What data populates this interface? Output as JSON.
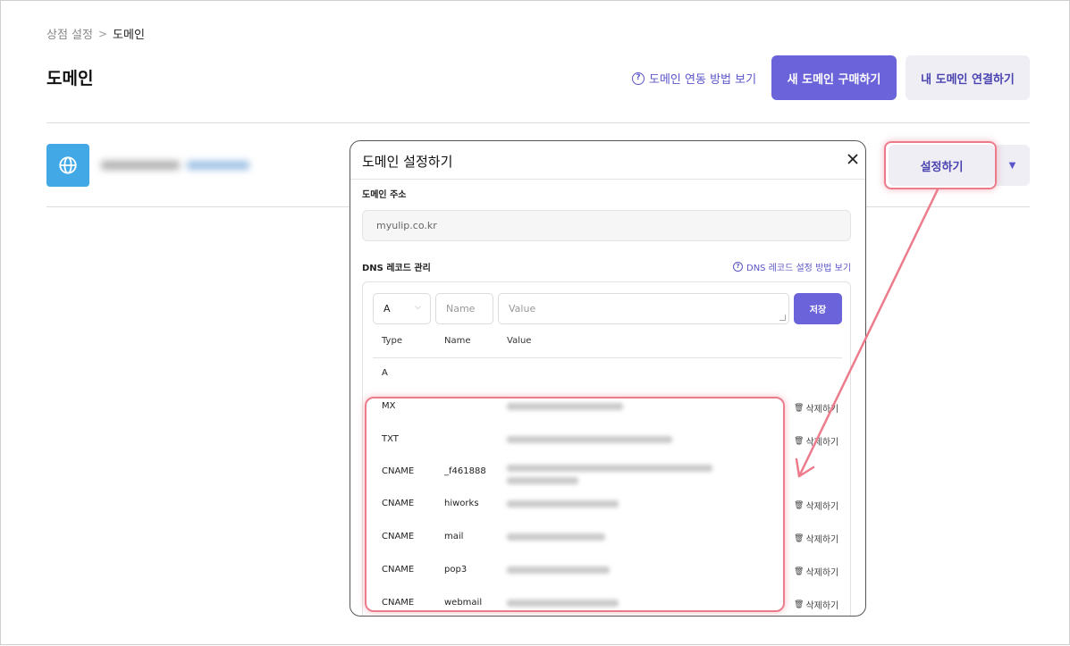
{
  "breadcrumb": {
    "parent": "상점 설정",
    "separator": ">",
    "current": "도메인"
  },
  "page": {
    "title": "도메인"
  },
  "header_actions": {
    "help_link": "도메인 연동 방법 보기",
    "buy_button": "새 도메인 구매하기",
    "connect_button": "내 도메인 연결하기"
  },
  "domain_row": {
    "settings_button": "설정하기"
  },
  "modal": {
    "title": "도메인 설정하기",
    "domain_label": "도메인 주소",
    "domain_value": "myulip.co.kr",
    "dns_label": "DNS 레코드 관리",
    "dns_help": "DNS 레코드 설정 방법 보기",
    "form": {
      "type_value": "A",
      "name_placeholder": "Name",
      "value_placeholder": "Value",
      "save_button": "저장"
    },
    "columns": {
      "type": "Type",
      "name": "Name",
      "value": "Value"
    },
    "delete_label": "삭제하기",
    "records": [
      {
        "type": "A",
        "name": ""
      },
      {
        "type": "MX",
        "name": ""
      },
      {
        "type": "TXT",
        "name": ""
      },
      {
        "type": "CNAME",
        "name": "_f461888"
      },
      {
        "type": "CNAME",
        "name": "hiworks"
      },
      {
        "type": "CNAME",
        "name": "mail"
      },
      {
        "type": "CNAME",
        "name": "pop3"
      },
      {
        "type": "CNAME",
        "name": "webmail"
      }
    ]
  },
  "colors": {
    "accent": "#6b63d9",
    "highlight": "#ec7b8c",
    "globe_bg": "#42a8e6"
  }
}
